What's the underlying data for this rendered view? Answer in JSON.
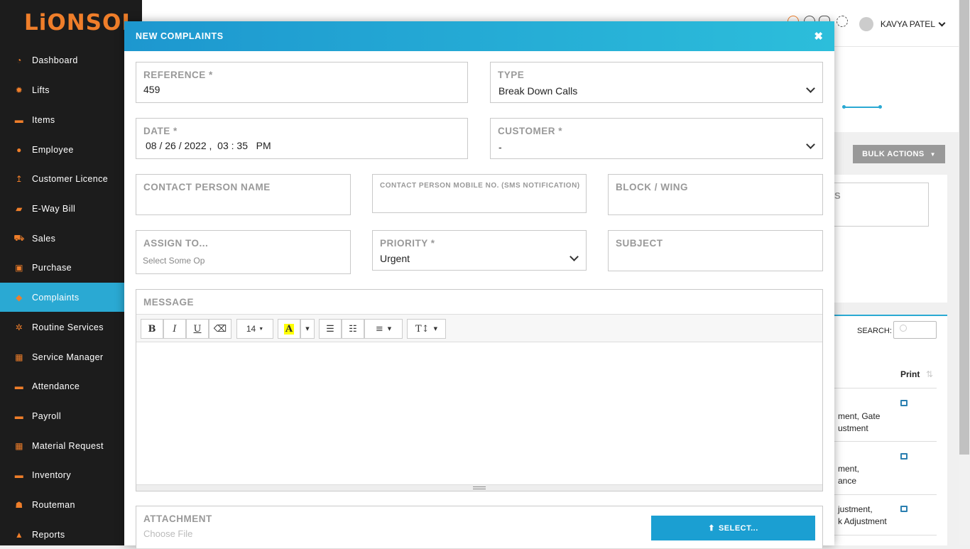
{
  "brand": {
    "logo": "LiONSOL"
  },
  "sidebar": {
    "items": [
      {
        "label": "Dashboard",
        "icon": "dashboard-icon"
      },
      {
        "label": "Lifts",
        "icon": "gear-icon"
      },
      {
        "label": "Items",
        "icon": "box-icon"
      },
      {
        "label": "Employee",
        "icon": "user-icon"
      },
      {
        "label": "Customer Licence",
        "icon": "arrow-up-icon"
      },
      {
        "label": "E-Way Bill",
        "icon": "truck-icon"
      },
      {
        "label": "Sales",
        "icon": "cart-icon"
      },
      {
        "label": "Purchase",
        "icon": "briefcase-icon"
      },
      {
        "label": "Complaints",
        "icon": "tag-icon",
        "active": true
      },
      {
        "label": "Routine Services",
        "icon": "gears-icon"
      },
      {
        "label": "Service Manager",
        "icon": "grid-icon"
      },
      {
        "label": "Attendance",
        "icon": "box-icon"
      },
      {
        "label": "Payroll",
        "icon": "box-icon"
      },
      {
        "label": "Material Request",
        "icon": "grid-icon"
      },
      {
        "label": "Inventory",
        "icon": "box-icon"
      },
      {
        "label": "Routeman",
        "icon": "users-icon"
      },
      {
        "label": "Reports",
        "icon": "chart-icon"
      }
    ]
  },
  "header": {
    "user_name": "KAVYA PATEL"
  },
  "background": {
    "bulk_actions": "BULK ACTIONS",
    "search_label": "SEARCH:",
    "print_header": "Print",
    "partial_s": "S",
    "rows": [
      {
        "line1": "ment, Gate",
        "line2": "ustment"
      },
      {
        "line1": "ment,",
        "line2": "ance"
      },
      {
        "line1": "justment,",
        "line2": "k Adjustment"
      }
    ]
  },
  "modal": {
    "title": "NEW COMPLAINTS",
    "reference": {
      "label": "REFERENCE *",
      "value": "459"
    },
    "type": {
      "label": "TYPE",
      "value": "Break Down Calls"
    },
    "date": {
      "label": "DATE *",
      "value": "08 / 26 / 2022 ,  03 : 35   PM"
    },
    "customer": {
      "label": "CUSTOMER *",
      "value": "-"
    },
    "contact_name": {
      "label": "CONTACT PERSON NAME"
    },
    "contact_mobile": {
      "label": "CONTACT PERSON MOBILE NO. (SMS NOTIFICATION)"
    },
    "block": {
      "label": "BLOCK / WING"
    },
    "assign": {
      "label": "ASSIGN TO...",
      "placeholder": "Select Some Op"
    },
    "priority": {
      "label": "PRIORITY *",
      "value": "Urgent"
    },
    "subject": {
      "label": "SUBJECT"
    },
    "message": {
      "label": "MESSAGE",
      "font_size": "14"
    },
    "attachment": {
      "label": "ATTACHMENT",
      "placeholder": "Choose File",
      "select_label": "SELECT..."
    }
  }
}
